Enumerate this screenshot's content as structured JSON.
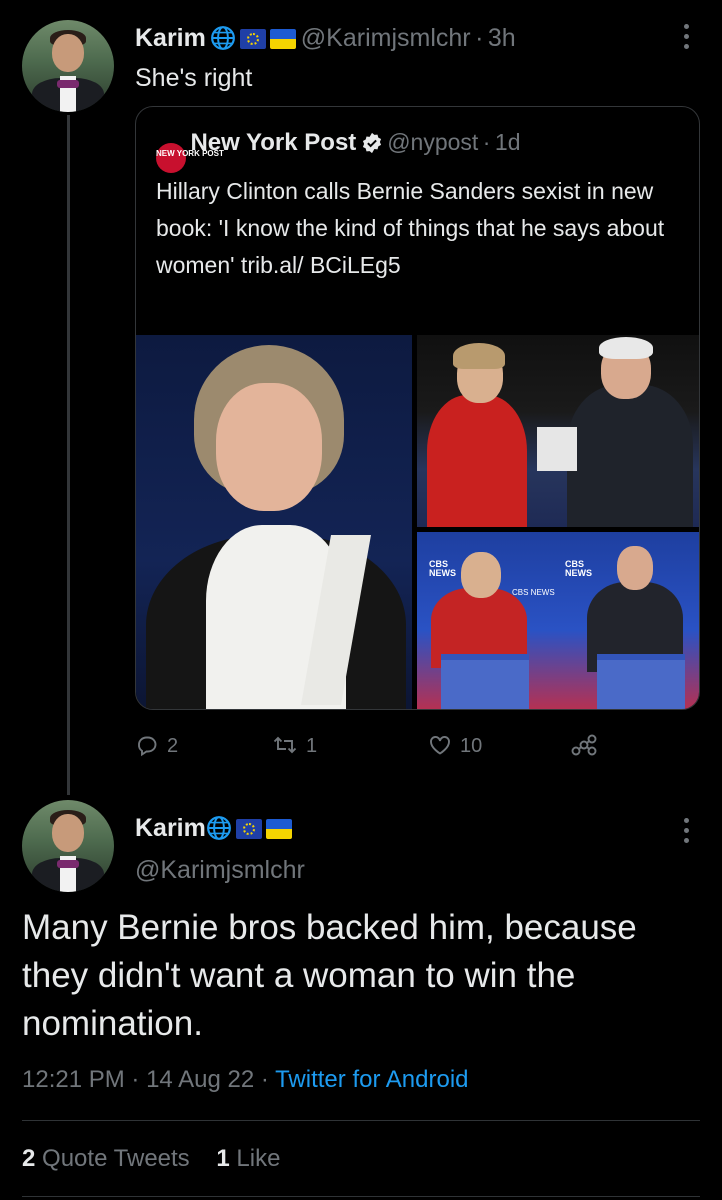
{
  "reply_tweet": {
    "author_name": "Karim",
    "handle": "@Karimjsmlchr",
    "separator": "·",
    "time": "3h",
    "text": "She's right"
  },
  "quoted_tweet": {
    "author_name": "New York Post",
    "handle": "@nypost",
    "separator": "·",
    "time": "1d",
    "text": "Hillary Clinton calls Bernie Sanders sexist in new book: 'I know the kind of things that he says about women' trib.al/ BCiLEg5",
    "logo_text": "NEW YORK POST",
    "media_labels": [
      "CBS NEWS",
      "CBS NEWS",
      "CBS NEWS"
    ]
  },
  "reply_actions": {
    "replies": "2",
    "retweets": "1",
    "likes": "10"
  },
  "main_tweet": {
    "author_name": "Karim",
    "handle": "@Karimjsmlchr",
    "text": "Many Bernie bros backed him, because they didn't want a woman to win the nomination.",
    "time": "12:21 PM",
    "sep1": "·",
    "date": "14 Aug 22",
    "sep2": "·",
    "source": "Twitter for Android",
    "quote_count": "2",
    "quote_label": "Quote Tweets",
    "like_count": "1",
    "like_label": "Like"
  },
  "colors": {
    "background": "#000000",
    "text": "#e7e9ea",
    "muted": "#71767b",
    "link": "#1d9bf0",
    "border": "#333639"
  },
  "icons": [
    "globe-icon",
    "eu-flag-icon",
    "ukraine-flag-icon",
    "more-icon",
    "verified-icon",
    "reply-icon",
    "retweet-icon",
    "like-icon",
    "share-icon"
  ]
}
